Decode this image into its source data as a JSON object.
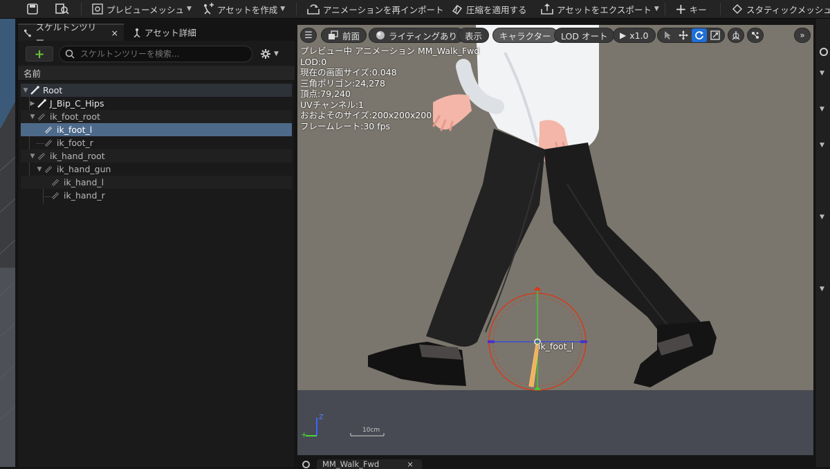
{
  "toolbar": {
    "preview_mesh": "プレビューメッシュ",
    "create_asset": "アセットを作成",
    "reimport": "アニメーションを再インポート",
    "apply_compression": "圧縮を適用する",
    "export_asset": "アセットをエクスポート",
    "key": "キー",
    "static_mesh": "スタティックメッシュ"
  },
  "panel": {
    "tab_skeleton": "スケルトンツリー",
    "tab_close": "×",
    "tab_asset_details": "アセット詳細",
    "add_label": "+",
    "search_placeholder": "スケルトンツリーを検索...",
    "column_name": "名前"
  },
  "tree": {
    "items": [
      {
        "label": "Root"
      },
      {
        "label": "J_Bip_C_Hips"
      },
      {
        "label": "ik_foot_root"
      },
      {
        "label": "ik_foot_l"
      },
      {
        "label": "ik_foot_r"
      },
      {
        "label": "ik_hand_root"
      },
      {
        "label": "ik_hand_gun"
      },
      {
        "label": "ik_hand_l"
      },
      {
        "label": "ik_hand_r"
      }
    ]
  },
  "viewport": {
    "perspective": "前面",
    "lighting": "ライティングあり",
    "show": "表示",
    "character": "キャラクター",
    "lod": "LOD オート",
    "play_speed": "x1.0",
    "stats": [
      "プレビュー中 アニメーション MM_Walk_Fwd",
      "LOD:0",
      "現在の画面サイズ:0.048",
      "三角ポリゴン:24,278",
      "頂点:79,240",
      "UVチャンネル:1",
      "おおよそのサイズ:200x200x200",
      "フレームレート:30 fps"
    ],
    "bone_label": "ik_foot_l",
    "scale_label": "10cm",
    "axis_z": "Z"
  },
  "bottom": {
    "tab_label": "MM_Walk_Fwd",
    "tab_close": "×"
  },
  "colors": {
    "accent_green": "#6bc13a",
    "selected_row": "#4e6a8a",
    "viewport_bg": "#7a766d",
    "floor": "#474a52"
  }
}
